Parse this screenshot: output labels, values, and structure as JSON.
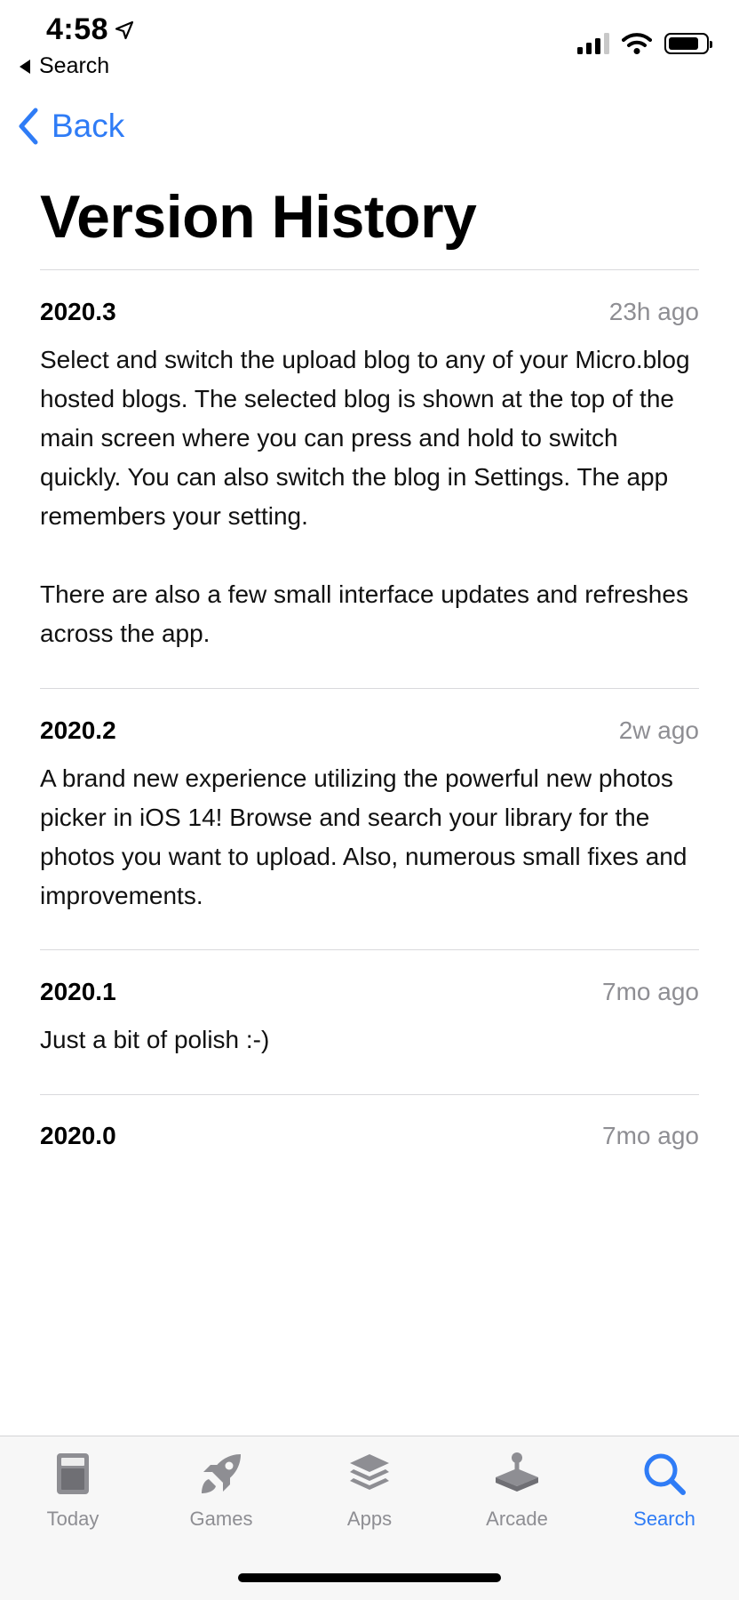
{
  "status_bar": {
    "time": "4:58",
    "back_app_label": "Search"
  },
  "nav": {
    "back_label": "Back"
  },
  "page": {
    "title": "Version History"
  },
  "versions": [
    {
      "version": "2020.3",
      "ago": "23h ago",
      "notes": [
        "Select and switch the upload blog to any of your Micro.blog hosted blogs. The selected blog is shown at the top of the main screen where you can press and hold to switch quickly. You can also switch the blog in Settings. The app remembers your setting.",
        "There are also a few small interface updates and refreshes across the app."
      ]
    },
    {
      "version": "2020.2",
      "ago": "2w ago",
      "notes": [
        "A brand new experience utilizing the powerful new photos picker in iOS 14! Browse and search your library for the photos you want to upload. Also, numerous small fixes and improvements."
      ]
    },
    {
      "version": "2020.1",
      "ago": "7mo ago",
      "notes": [
        "Just a bit of polish :-)"
      ]
    },
    {
      "version": "2020.0",
      "ago": "7mo ago",
      "notes": []
    }
  ],
  "tab_bar": {
    "tabs": [
      {
        "label": "Today",
        "icon": "today-icon",
        "active": false
      },
      {
        "label": "Games",
        "icon": "rocket-icon",
        "active": false
      },
      {
        "label": "Apps",
        "icon": "layers-icon",
        "active": false
      },
      {
        "label": "Arcade",
        "icon": "joystick-icon",
        "active": false
      },
      {
        "label": "Search",
        "icon": "search-icon",
        "active": true
      }
    ]
  },
  "colors": {
    "accent": "#2f7cf6",
    "secondary_text": "#8e8e93",
    "divider": "#d9d9dc"
  }
}
